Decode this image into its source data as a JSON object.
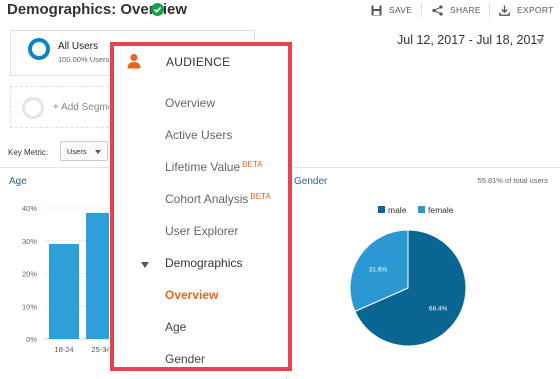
{
  "header": {
    "title": "Demographics: Overview",
    "actions": [
      {
        "label": "SAVE",
        "icon": "save-icon"
      },
      {
        "label": "SHARE",
        "icon": "share-icon"
      },
      {
        "label": "EXPORT",
        "icon": "export-icon"
      }
    ]
  },
  "segment": {
    "title": "All Users",
    "subtitle": "100.00% Users"
  },
  "add_segment": {
    "label": "+ Add Segme"
  },
  "date_range": {
    "label": "Jul 12, 2017 - Jul 18, 2017"
  },
  "key_metric": {
    "label": "Key Metric:",
    "value": "Users"
  },
  "colors": {
    "accent_blue": "#0d83c5",
    "bar_blue": "#2e9fd8",
    "male": "#0a6593",
    "female": "#2b98d2",
    "menu_border": "#e8424a",
    "active_orange": "#e5671b"
  },
  "menu": {
    "header": "AUDIENCE",
    "header_icon": "person-icon",
    "items": [
      {
        "label": "Overview",
        "beta": ""
      },
      {
        "label": "Active Users",
        "beta": ""
      },
      {
        "label": "Lifetime Value",
        "beta": "BETA"
      },
      {
        "label": "Cohort Analysis",
        "beta": "BETA"
      },
      {
        "label": "User Explorer",
        "beta": ""
      }
    ],
    "section": {
      "label": "Demographics",
      "icon": "expanded-triangle-icon"
    },
    "sub_items": [
      {
        "label": "Overview",
        "active": true
      },
      {
        "label": "Age",
        "active": false
      },
      {
        "label": "Gender",
        "active": false
      }
    ]
  },
  "age_panel": {
    "title": "Age"
  },
  "gender_panel": {
    "title": "Gender",
    "total": "55.81% of total users"
  },
  "chart_data": [
    {
      "type": "bar",
      "title": "Age",
      "categories": [
        "18-24",
        "25-34"
      ],
      "values": [
        29,
        38.5
      ],
      "yticks": [
        "0%",
        "10%",
        "20%",
        "30%",
        "40%"
      ],
      "ylim": [
        0,
        40
      ],
      "grid": true
    },
    {
      "type": "pie",
      "title": "Gender",
      "legend_position": "top",
      "labels": [
        "male",
        "female"
      ],
      "values": [
        68.4,
        31.6
      ],
      "value_labels": [
        "68.4%",
        "31.6%"
      ]
    }
  ]
}
